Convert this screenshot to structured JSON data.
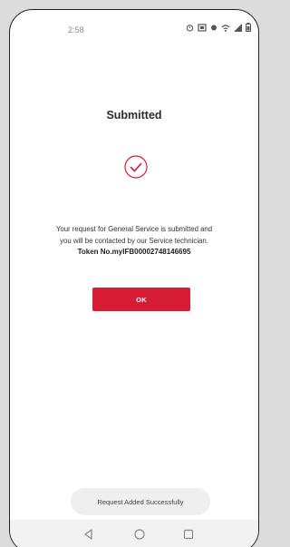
{
  "status_bar": {
    "time": "2:58"
  },
  "page": {
    "title": "Submitted"
  },
  "message": {
    "line1": "Your request for General Service is submitted and",
    "line2": "you will be contacted by our Service technician.",
    "token": "Token No.myIFB00002748146695"
  },
  "actions": {
    "ok_label": "OK"
  },
  "toast": {
    "text": "Request Added Successfully"
  },
  "colors": {
    "accent": "#d71c36",
    "check": "#d71c36"
  },
  "icons": {
    "status": [
      "alarm-icon",
      "nfc-icon",
      "vibrate-icon",
      "wifi-icon",
      "signal-icon",
      "battery-icon"
    ],
    "nav": [
      "back-icon",
      "home-icon",
      "recents-icon"
    ]
  }
}
